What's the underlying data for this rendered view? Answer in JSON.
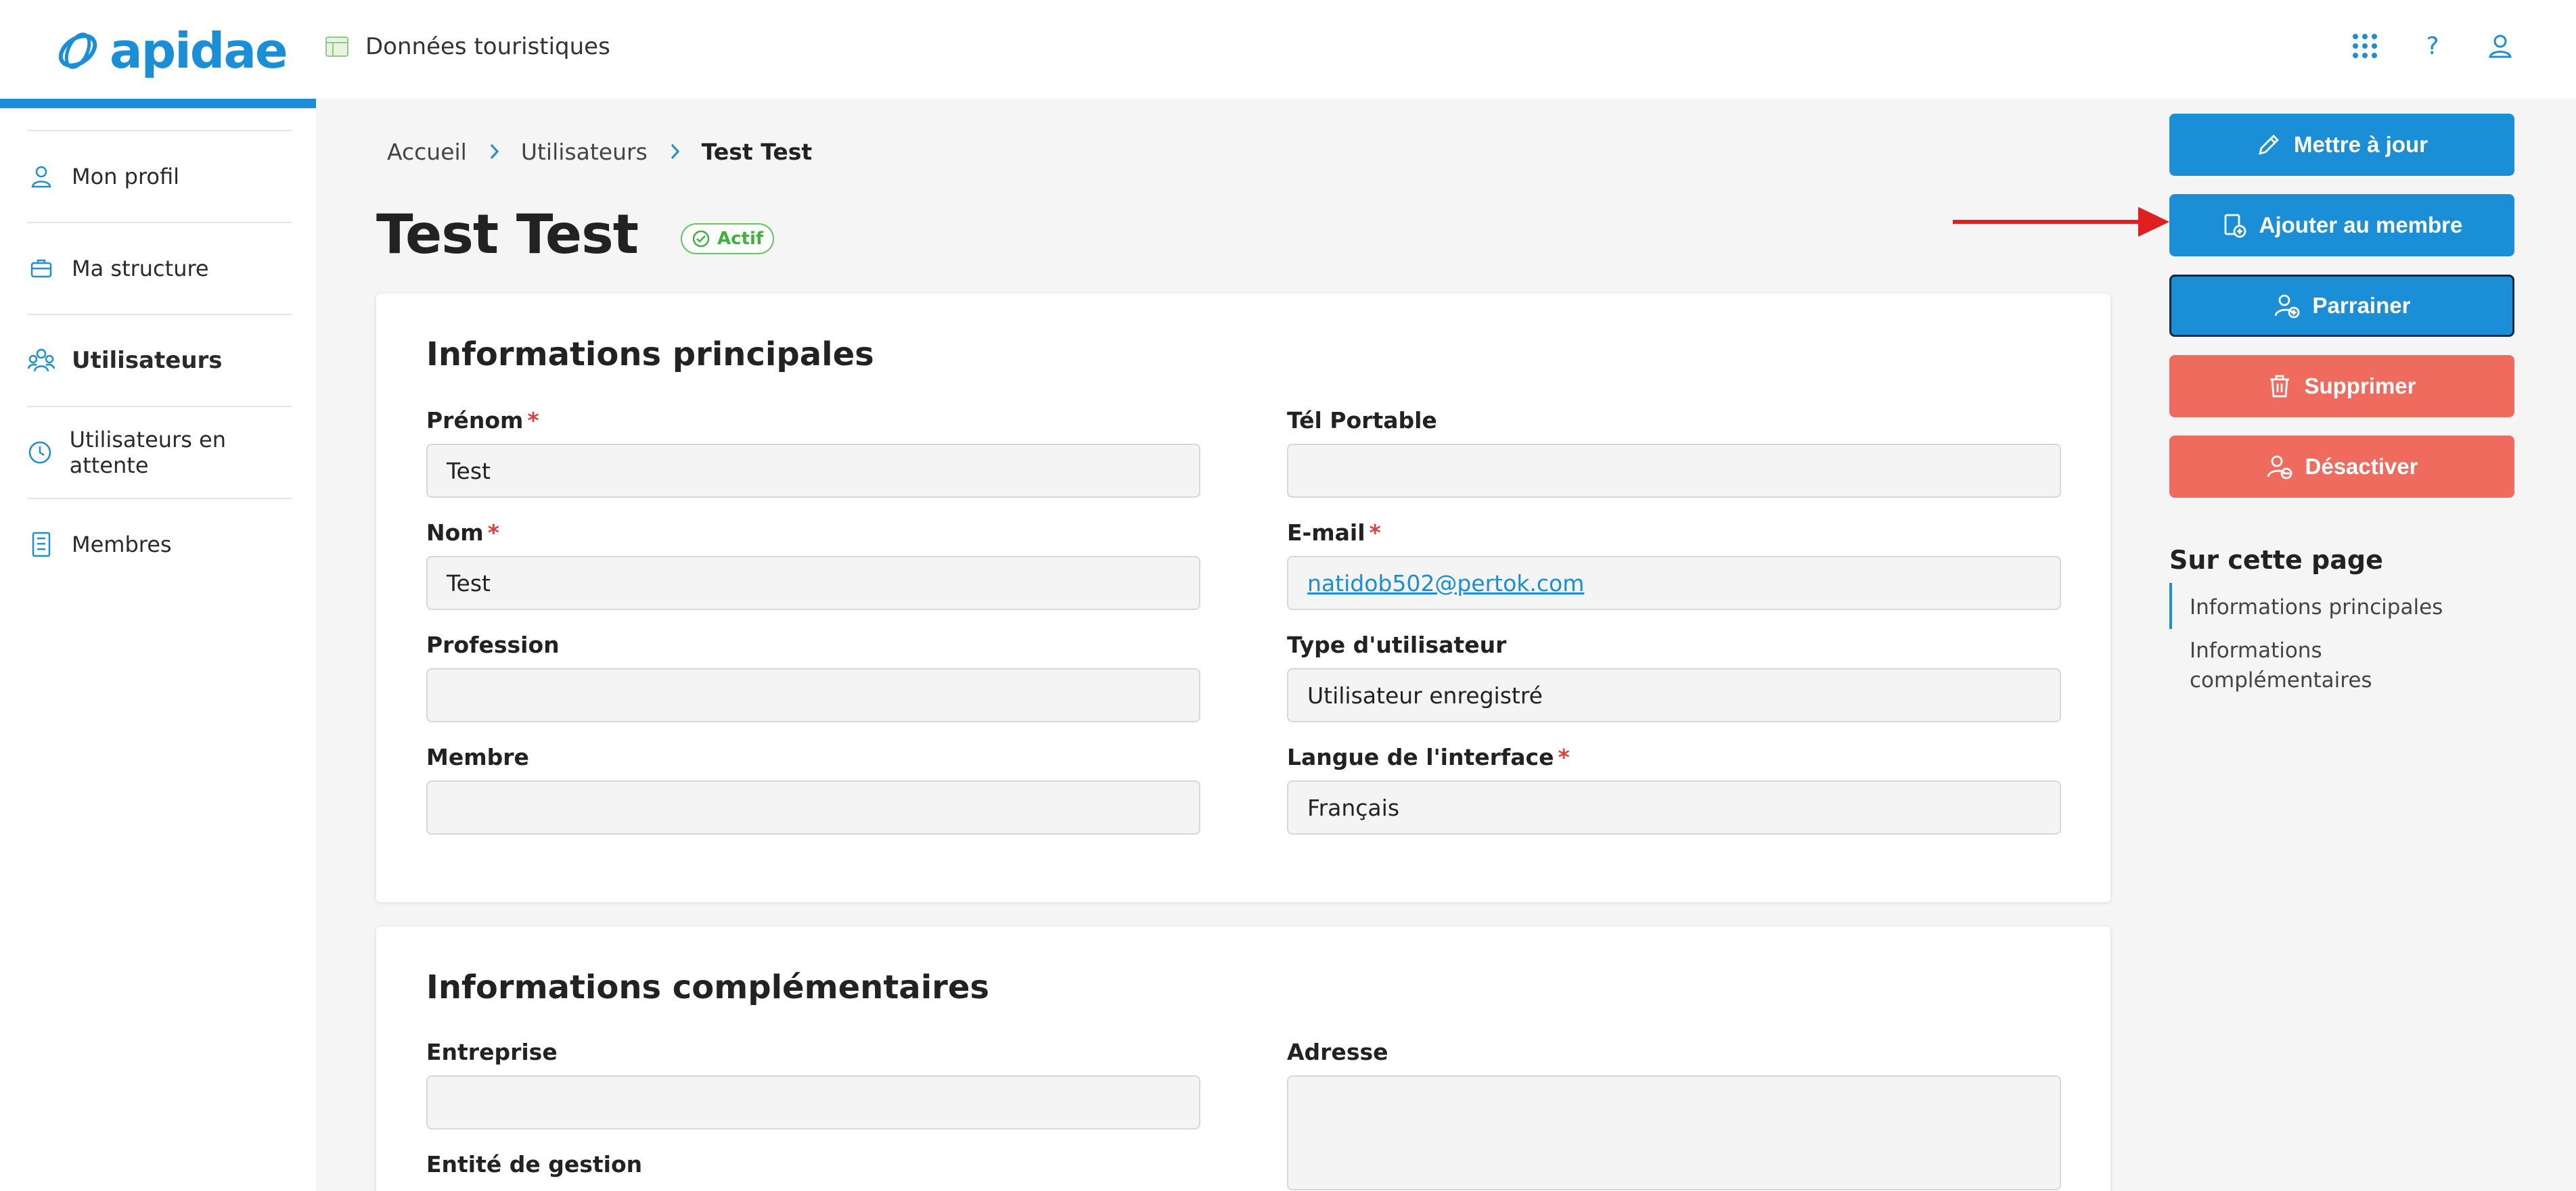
{
  "header": {
    "logo_text": "apidae",
    "section_label": "Données touristiques",
    "icons": [
      "apps-grid-icon",
      "help-icon",
      "user-icon"
    ],
    "help_glyph": "?"
  },
  "sidebar": {
    "items": [
      {
        "label": "Mon profil",
        "icon": "user-icon",
        "active": false
      },
      {
        "label": "Ma structure",
        "icon": "briefcase-icon",
        "active": false
      },
      {
        "label": "Utilisateurs",
        "icon": "users-icon",
        "active": true
      },
      {
        "label": "Utilisateurs en attente",
        "icon": "clock-icon",
        "active": false
      },
      {
        "label": "Membres",
        "icon": "building-icon",
        "active": false
      }
    ]
  },
  "breadcrumb": {
    "items": [
      "Accueil",
      "Utilisateurs",
      "Test Test"
    ]
  },
  "page": {
    "title": "Test Test",
    "status": "Actif"
  },
  "main_info": {
    "title": "Informations principales",
    "fields": {
      "prenom": {
        "label": "Prénom",
        "value": "Test",
        "required": "*"
      },
      "tel": {
        "label": "Tél Portable",
        "value": ""
      },
      "nom": {
        "label": "Nom",
        "value": "Test",
        "required": "*"
      },
      "email": {
        "label": "E-mail",
        "value": "natidob502@pertok.com",
        "required": "*"
      },
      "profession": {
        "label": "Profession",
        "value": ""
      },
      "type": {
        "label": "Type d'utilisateur",
        "value": "Utilisateur enregistré"
      },
      "membre": {
        "label": "Membre",
        "value": ""
      },
      "langue": {
        "label": "Langue de l'interface",
        "value": "Français",
        "required": "*"
      }
    }
  },
  "extra_info": {
    "title": "Informations complémentaires",
    "fields": {
      "entreprise": {
        "label": "Entreprise",
        "value": ""
      },
      "adresse": {
        "label": "Adresse",
        "value": ""
      },
      "entite": {
        "label": "Entité de gestion",
        "value": ""
      }
    }
  },
  "actions": {
    "update": "Mettre à jour",
    "add_member": "Ajouter au membre",
    "sponsor": "Parrainer",
    "delete": "Supprimer",
    "deactivate": "Désactiver"
  },
  "toc": {
    "title": "Sur cette page",
    "items": [
      "Informations principales",
      "Informations complémentaires"
    ]
  },
  "colors": {
    "accent": "#1a8fd8",
    "danger": "#ef6b5d",
    "success": "#3db33d",
    "annotation_arrow": "#e02020"
  }
}
